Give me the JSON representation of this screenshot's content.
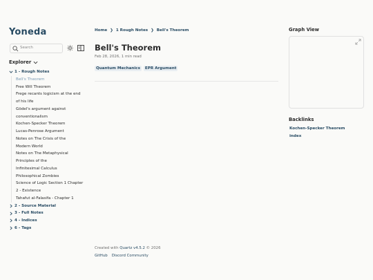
{
  "site": {
    "title": "Yoneda"
  },
  "search": {
    "placeholder": "Search"
  },
  "explorer": {
    "title": "Explorer",
    "open_folder": "1 - Rough Notes",
    "notes": [
      "Bell's Theorem",
      "Free Will Theorem",
      "Frege recants logicism at the end",
      "of his life",
      "Gödel's argument against",
      "conventionalism",
      "Kochen-Specker Theorem",
      "Lucas-Penrose Argument",
      "Notes on The Crisis of the",
      "Modern World",
      "Notes on The Metaphysical",
      "Principles of the",
      "Infinitesimal Calculus",
      "Philosophical Zombies",
      "Science of Logic Section 1 Chapter",
      "2 - Existence",
      "Tahafut al-Falasifa - Chapter 1"
    ],
    "folders": [
      "2 - Source Material",
      "3 - Full Notes",
      "4 - Indices",
      "6 - Tags"
    ]
  },
  "breadcrumb": {
    "home": "Home",
    "folder": "1 Rough Notes",
    "current": "Bell's Theorem",
    "separator": "❯"
  },
  "article": {
    "title": "Bell's Theorem",
    "meta": "Feb 28, 2026, 1 min read",
    "tags": [
      "Quantum Mechanics",
      "EPR Argument"
    ]
  },
  "footer": {
    "created_prefix": "Created with",
    "quartz": "Quartz v4.5.2",
    "year": "© 2026",
    "links": [
      "GitHub",
      "Discord Community"
    ]
  },
  "graph": {
    "title": "Graph View"
  },
  "backlinks": {
    "title": "Backlinks",
    "items": [
      "Kochen-Specker Theorem",
      "index"
    ]
  },
  "colors": {
    "accent": "#284b63",
    "active_note": "#7a9bb5",
    "text": "#2b2b2b",
    "background": "#fafaf8"
  }
}
